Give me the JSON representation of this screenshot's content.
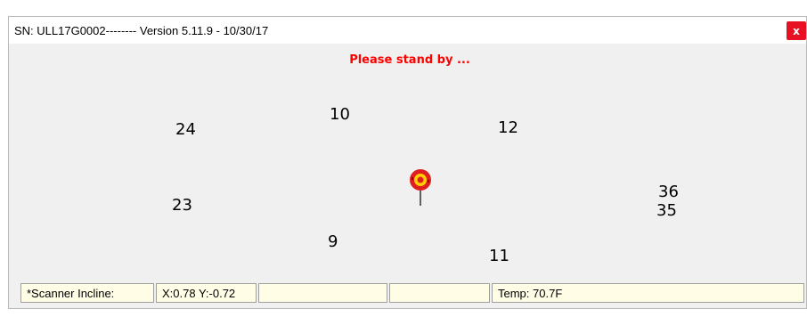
{
  "window": {
    "title": "SN: ULL17G0002-------- Version 5.11.9 - 10/30/17",
    "close_label": "x"
  },
  "main": {
    "status_message": "Please stand by ...",
    "target_numbers": [
      "24",
      "10",
      "12",
      "23",
      "36",
      "35",
      "9",
      "11"
    ],
    "target_icon": "bullseye-target-icon"
  },
  "statusbar": {
    "cells": [
      "*Scanner Incline:",
      "X:0.78 Y:-0.72",
      "",
      "",
      "Temp: 70.7F"
    ]
  },
  "colors": {
    "close_button": "#e81123",
    "status_message": "#ff0000",
    "statusbar_cell_bg": "#fffde6",
    "target_outer": "#e02020",
    "target_middle": "#ffd000"
  }
}
